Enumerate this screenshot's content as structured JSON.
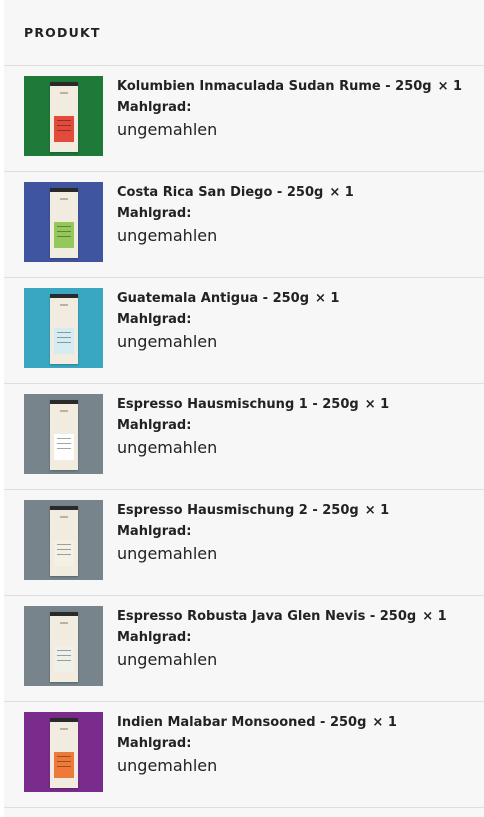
{
  "header": {
    "title": "PRODUKT"
  },
  "items": [
    {
      "name": "Kolumbien Inmaculada Sudan Rume - 250g",
      "qty": "× 1",
      "grind_label": "Mahlgrad:",
      "grind_value": "ungemahlen",
      "bg_color": "#1f7a3a",
      "label_color": "#e24b3b"
    },
    {
      "name": "Costa Rica San Diego - 250g",
      "qty": "× 1",
      "grind_label": "Mahlgrad:",
      "grind_value": "ungemahlen",
      "bg_color": "#3f55a0",
      "label_color": "#95c85a"
    },
    {
      "name": "Guatemala Antigua - 250g",
      "qty": "× 1",
      "grind_label": "Mahlgrad:",
      "grind_value": "ungemahlen",
      "bg_color": "#3aa7c2",
      "label_color": "#d6ecf3"
    },
    {
      "name": "Espresso Hausmischung 1 - 250g",
      "qty": "× 1",
      "grind_label": "Mahlgrad:",
      "grind_value": "ungemahlen",
      "bg_color": "#77848c",
      "label_color": "#ffffff"
    },
    {
      "name": "Espresso Hausmischung 2 - 250g",
      "qty": "× 1",
      "grind_label": "Mahlgrad:",
      "grind_value": "ungemahlen",
      "bg_color": "#77848c",
      "label_color": "#f3f1e6"
    },
    {
      "name": "Espresso Robusta Java Glen Nevis - 250g",
      "qty": "× 1",
      "grind_label": "Mahlgrad:",
      "grind_value": "ungemahlen",
      "bg_color": "#77848c",
      "label_color": "#eef1ea"
    },
    {
      "name": "Indien Malabar Monsooned - 250g",
      "qty": "× 1",
      "grind_label": "Mahlgrad:",
      "grind_value": "ungemahlen",
      "bg_color": "#7a2c8c",
      "label_color": "#ee7a3a"
    }
  ]
}
